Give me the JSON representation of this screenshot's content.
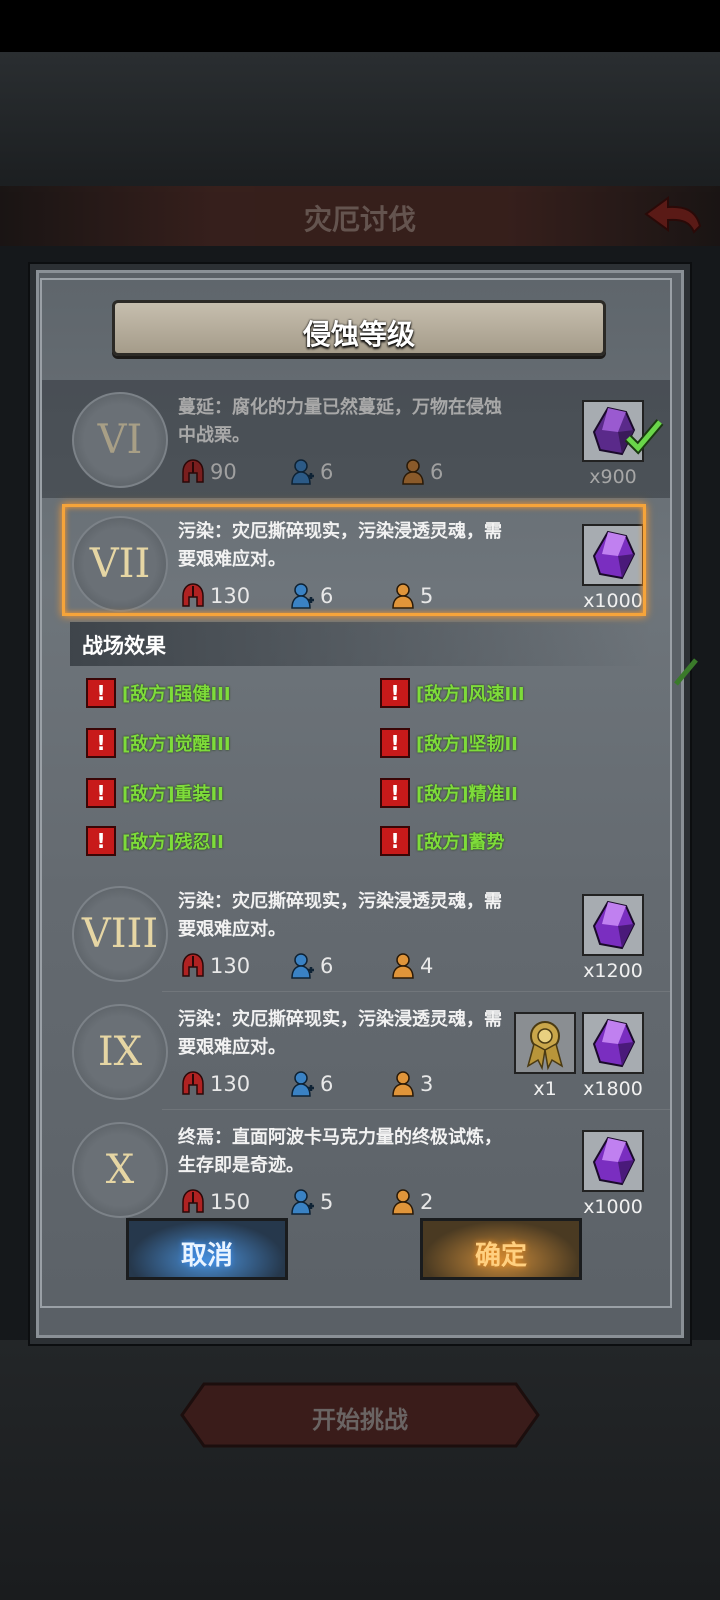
{
  "screen": {
    "title": "灾厄讨伐",
    "start_button": "开始挑战"
  },
  "dialog": {
    "title": "侵蚀等级",
    "cancel_label": "取消",
    "confirm_label": "确定",
    "effects_title": "战场效果",
    "levels": [
      {
        "numeral": "VI",
        "desc": "蔓延：腐化的力量已然蔓延，万物在侵蚀中战栗。",
        "enemy": "90",
        "ally": "6",
        "person": "6",
        "rewards": [
          {
            "icon": "purple-crystal-icon",
            "count": "x900",
            "claimed": true
          }
        ]
      },
      {
        "numeral": "VII",
        "desc": "污染：灾厄撕碎现实，污染浸透灵魂，需要艰难应对。",
        "enemy": "130",
        "ally": "6",
        "person": "5",
        "selected": true,
        "rewards": [
          {
            "icon": "purple-crystal-icon",
            "count": "x1000"
          }
        ]
      },
      {
        "numeral": "VIII",
        "desc": "污染：灾厄撕碎现实，污染浸透灵魂，需要艰难应对。",
        "enemy": "130",
        "ally": "6",
        "person": "4",
        "rewards": [
          {
            "icon": "purple-crystal-icon",
            "count": "x1200"
          }
        ]
      },
      {
        "numeral": "IX",
        "desc": "污染：灾厄撕碎现实，污染浸透灵魂，需要艰难应对。",
        "enemy": "130",
        "ally": "6",
        "person": "3",
        "rewards": [
          {
            "icon": "golden-emblem-icon",
            "count": "x1"
          },
          {
            "icon": "purple-crystal-icon",
            "count": "x1800"
          }
        ]
      },
      {
        "numeral": "X",
        "desc": "终焉：直面阿波卡马克力量的终极试炼，生存即是奇迹。",
        "enemy": "150",
        "ally": "5",
        "person": "2",
        "rewards": [
          {
            "icon": "purple-crystal-icon",
            "count": "x1000"
          }
        ]
      }
    ],
    "effects": [
      "[敌方]强健III",
      "[敌方]风速III",
      "[敌方]觉醒III",
      "[敌方]坚韧II",
      "[敌方]重装II",
      "[敌方]精准II",
      "[敌方]残忍II",
      "[敌方]蓄势"
    ]
  },
  "colors": {
    "highlight": "#f6a43a",
    "effect_text": "#7edc3a",
    "warn": "#c81a1a",
    "crystal": "#7a2ec0"
  }
}
